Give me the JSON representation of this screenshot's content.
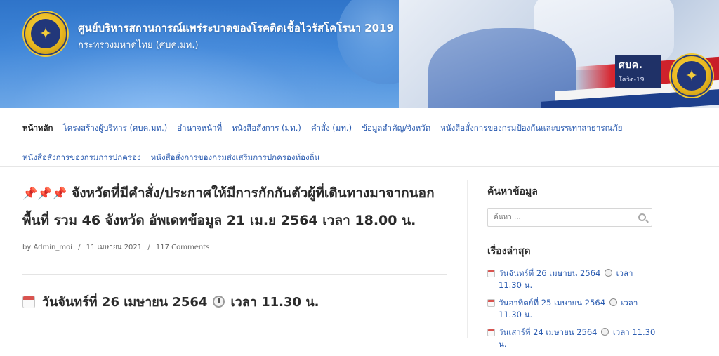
{
  "header": {
    "title": "ศูนย์บริหารสถานการณ์แพร่ระบาดของโรคติดเชื้อไวรัสโคโรนา 2019",
    "subtitle": "กระทรวงมหาดไทย (ศบค.มท.)",
    "badge_title": "ศบค.",
    "badge_sub": "โควิด-19"
  },
  "nav": {
    "row1": [
      "หน้าหลัก",
      "โครงสร้างผู้บริหาร (ศบค.มท.)",
      "อำนาจหน้าที่",
      "หนังสือสั่งการ (มท.)",
      "คำสั่ง (มท.)",
      "ข้อมูลสำคัญ/จังหวัด",
      "หนังสือสั่งการของกรมป้องกันและบรรเทาสาธารณภัย"
    ],
    "row2": [
      "หนังสือสั่งการของกรมการปกครอง",
      "หนังสือสั่งการของกรมส่งเสริมการปกครองท้องถิ่น"
    ]
  },
  "post": {
    "pins": "📌📌📌",
    "title": "จังหวัดที่มีคำสั่ง/ประกาศให้มีการกักกันตัวผู้ที่เดินทางมาจากนอกพื้นที่ รวม 46 จังหวัด อัพเดทข้อมูล 21 เม.ย 2564 เวลา 18.00 น.",
    "author": "by Admin_moi",
    "date": "11 เมษายน 2021",
    "comments": "117 Comments",
    "sub_date": "วันจันทร์ที่ 26 เมษายน 2564",
    "sub_time": "เวลา 11.30 น."
  },
  "sidebar": {
    "search_title": "ค้นหาข้อมูล",
    "search_placeholder": "ค้นหา …",
    "recent_title": "เรื่องล่าสุด",
    "recent": [
      {
        "date": "วันจันทร์ที่ 26 เมษายน 2564",
        "time": "เวลา 11.30 น."
      },
      {
        "date": "วันอาทิตย์ที่ 25 เมษายน 2564",
        "time": "เวลา 11.30 น."
      },
      {
        "date": "วันเสาร์ที่ 24 เมษายน 2564",
        "time": "เวลา 11.30 น."
      }
    ]
  },
  "colors": {
    "link": "#2a5bb0",
    "banner_blue": "#3f86d8",
    "badge_navy": "#1f3167"
  }
}
